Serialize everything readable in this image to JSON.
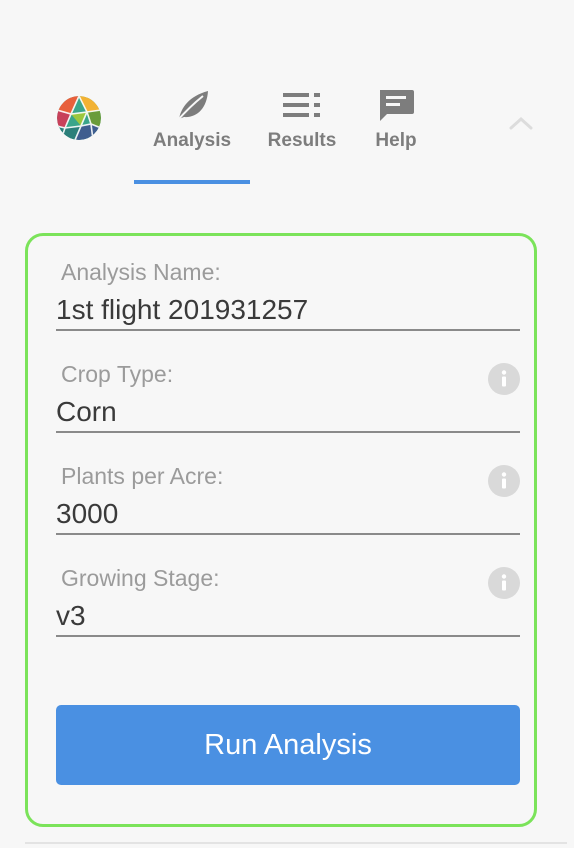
{
  "tabs": [
    {
      "label": "Analysis",
      "icon": "leaf-icon",
      "active": true
    },
    {
      "label": "Results",
      "icon": "list-icon",
      "active": false
    },
    {
      "label": "Help",
      "icon": "chat-icon",
      "active": false
    }
  ],
  "form": {
    "fields": [
      {
        "label": "Analysis Name:",
        "value": "1st flight 201931257",
        "has_info": false
      },
      {
        "label": "Crop Type:",
        "value": "Corn",
        "has_info": true
      },
      {
        "label": "Plants per Acre:",
        "value": "3000",
        "has_info": true
      },
      {
        "label": "Growing Stage:",
        "value": "v3",
        "has_info": true
      }
    ],
    "submit_label": "Run Analysis"
  },
  "colors": {
    "accent": "#4a90e2",
    "card_border": "#7be35a",
    "label": "#9b9b9b",
    "text": "#3a3a3a",
    "tab_icon": "#7d7d7d",
    "info_bg": "#d9d9d9"
  },
  "icons": {
    "logo": "globe-logo-icon",
    "collapse": "chevron-up-icon",
    "info": "info-icon"
  }
}
